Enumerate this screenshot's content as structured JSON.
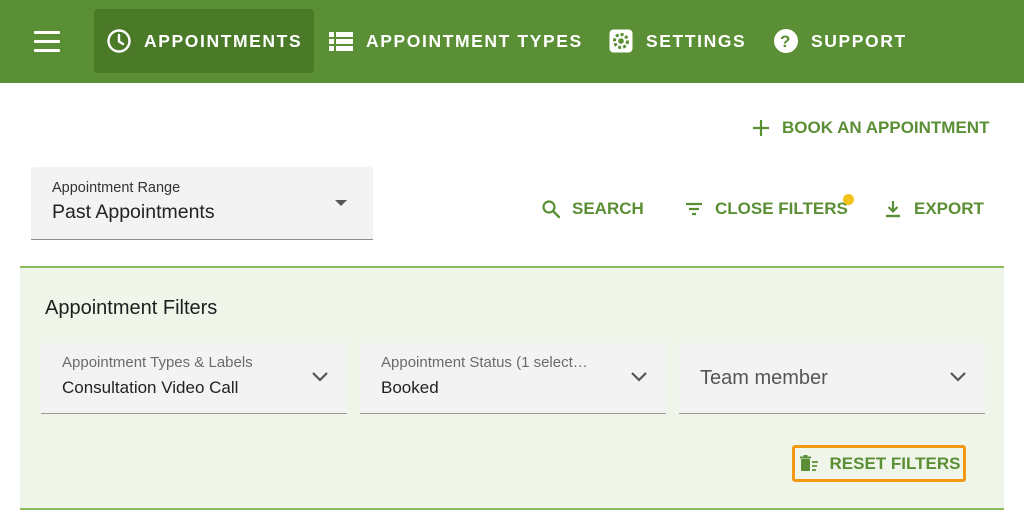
{
  "nav": {
    "menu_icon": "hamburger-menu-icon",
    "items": [
      {
        "label": "APPOINTMENTS",
        "icon": "clock-icon",
        "active": true
      },
      {
        "label": "APPOINTMENT TYPES",
        "icon": "list-icon",
        "active": false
      },
      {
        "label": "SETTINGS",
        "icon": "gear-icon",
        "active": false
      },
      {
        "label": "SUPPORT",
        "icon": "help-circle-icon",
        "active": false
      }
    ]
  },
  "actions": {
    "book": "BOOK AN APPOINTMENT",
    "search": "SEARCH",
    "close_filters": "CLOSE FILTERS",
    "export": "EXPORT"
  },
  "range": {
    "label": "Appointment Range",
    "value": "Past Appointments"
  },
  "filters": {
    "title": "Appointment Filters",
    "types": {
      "label": "Appointment Types & Labels",
      "value": "Consultation Video Call"
    },
    "status": {
      "label": "Appointment Status (1 select…",
      "value": "Booked"
    },
    "team": {
      "placeholder": "Team member"
    },
    "reset": "RESET FILTERS"
  },
  "colors": {
    "brand_green": "#5b8f35",
    "active_nav": "#4a7a28",
    "panel_bg": "#f0f5ea",
    "badge": "#f3c21a",
    "highlight": "#f39a14"
  }
}
